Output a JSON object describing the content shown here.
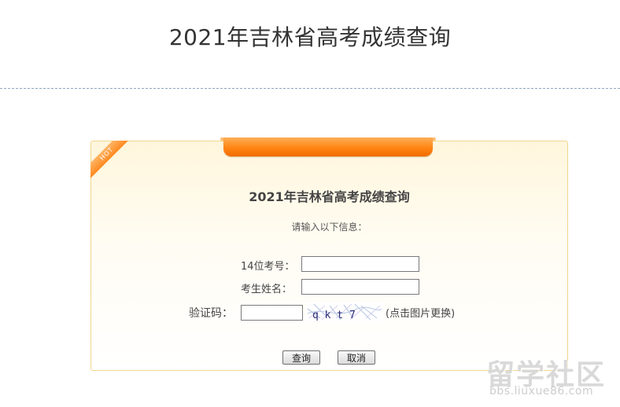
{
  "page": {
    "title": "2021年吉林省高考成绩查询"
  },
  "panel": {
    "hot_badge": "HOT",
    "form_title": "2021年吉林省高考成绩查询",
    "prompt": "请输入以下信息："
  },
  "form": {
    "exam_no_label": "14位考号：",
    "exam_no_value": "",
    "name_label": "考生姓名：",
    "name_value": "",
    "captcha_label": "验证码：",
    "captcha_value": "",
    "captcha_text": "q k t 7",
    "captcha_hint": "(点击图片更换)"
  },
  "buttons": {
    "query": "查询",
    "cancel": "取消"
  },
  "watermark": {
    "main": "留学社区",
    "url": "bbs.liuxue86.com"
  },
  "colors": {
    "accent_orange": "#ff8514",
    "panel_border": "#f1d58c",
    "divider": "#8aa5bd"
  }
}
